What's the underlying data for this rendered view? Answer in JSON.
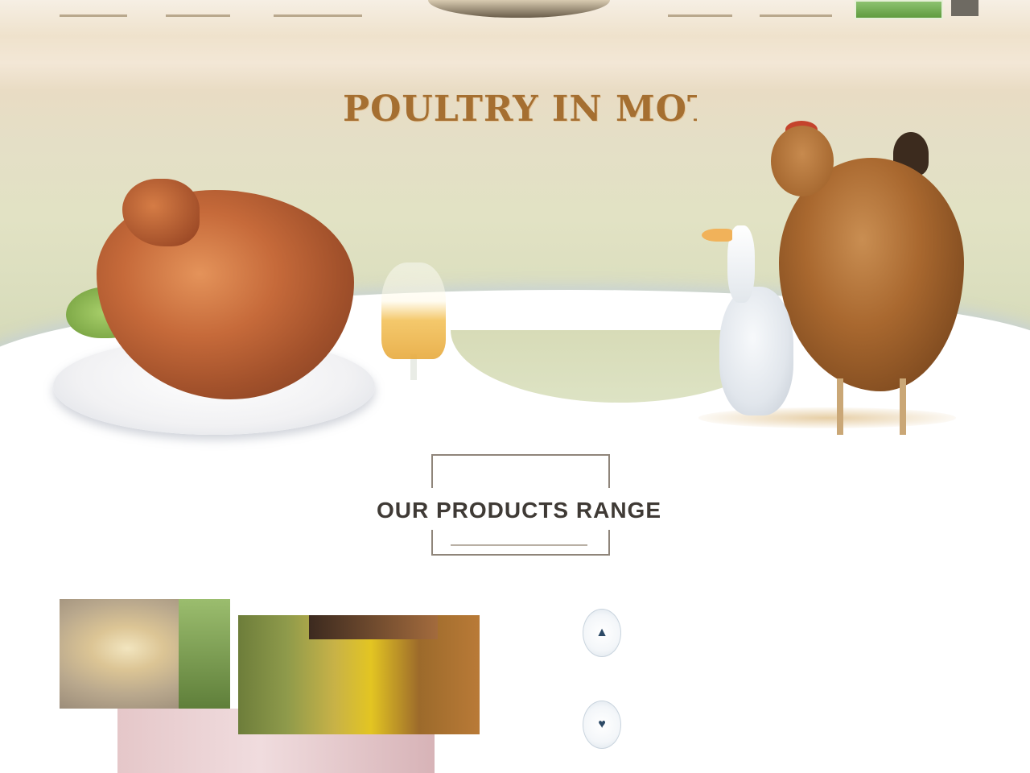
{
  "nav": {
    "items": [
      "",
      "",
      "",
      "",
      ""
    ],
    "logo_text": "",
    "cta_label": ""
  },
  "hero": {
    "title": "POULTRY IN MOTION",
    "subtitle": ""
  },
  "products": {
    "kicker": "",
    "title": "OUR PRODUCTS RANGE"
  },
  "features": [
    {
      "title": "",
      "text": "",
      "icon": "leaf-icon"
    },
    {
      "title": "",
      "text": "",
      "icon": "heart-icon"
    }
  ],
  "colors": {
    "accent": "#a56f31",
    "cta": "#6fae4c",
    "feature_blue": "#2d4a66"
  }
}
